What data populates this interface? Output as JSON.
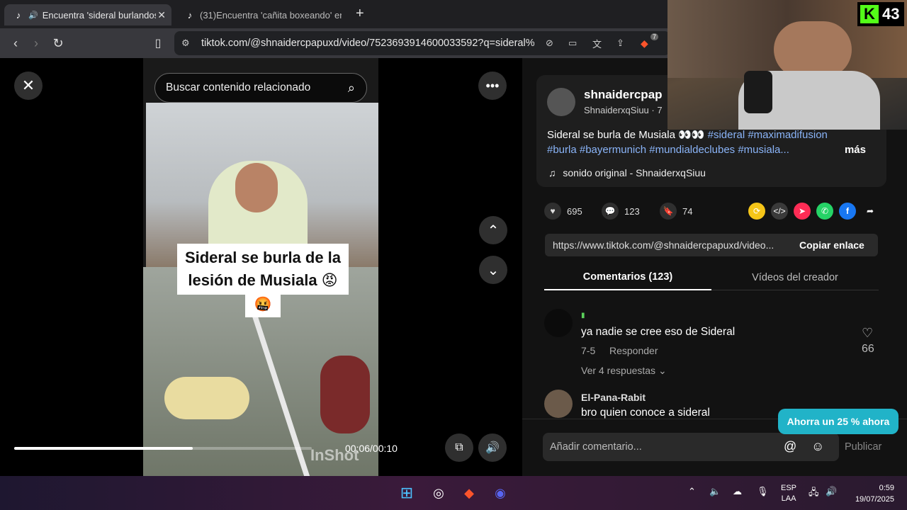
{
  "browser": {
    "tabs": [
      {
        "title": "Encuentra 'sideral burlandose",
        "active": true
      },
      {
        "title": "(31)Encuentra 'cañita boxeando' en T",
        "active": false
      }
    ],
    "new_tab_label": "+",
    "url": "tiktok.com/@shnaidercpapuxd/video/7523693914600033592?q=sideral%2...",
    "extension_badge": "7"
  },
  "player": {
    "search_placeholder": "Buscar contenido relacionado",
    "caption_line1": "Sideral se burla de la",
    "caption_line2": "lesión de Musiala 😡",
    "caption_line3": "🤬",
    "watermark": "InShot",
    "time": "00:06/00:10",
    "progress": 0.6
  },
  "post": {
    "username": "shnaidercpap",
    "handle": "ShnaiderxqSiuu · 7",
    "desc_text": "Sideral se burla de Musiala 👀👀 ",
    "hashtags_line1": "#sideral #maximadifusion",
    "hashtags_line2": "#burla #bayermunich #mundialdeclubes #musiala...",
    "more": "más",
    "sound": "sonido original - ShnaiderxqSiuu"
  },
  "actions": {
    "likes": "695",
    "comments": "123",
    "saves": "74"
  },
  "link": {
    "url": "https://www.tiktok.com/@shnaidercpapuxd/video...",
    "copy_label": "Copiar enlace"
  },
  "tabs": {
    "comments": "Comentarios (123)",
    "creator_videos": "Vídeos del creador"
  },
  "comments": [
    {
      "user": "▮",
      "text": "ya nadie se cree eso de Sideral",
      "date": "7-5",
      "reply": "Responder",
      "likes": "66",
      "replies": "Ver 4 respuestas"
    },
    {
      "user": "El-Pana-Rabit",
      "text": "bro quien conoce a sideral"
    }
  ],
  "comment_input": {
    "placeholder": "Añadir comentario...",
    "publish": "Publicar"
  },
  "promo": "Ahorra un 25 % ahora",
  "stream": {
    "viewer_count": "43"
  },
  "taskbar": {
    "lang1": "ESP",
    "lang2": "LAA",
    "time": "0:59",
    "date": "19/07/2025"
  },
  "colors": {
    "accent_blue": "#8ab4f8",
    "promo": "#21b3c8",
    "kick_green": "#53fc18"
  }
}
